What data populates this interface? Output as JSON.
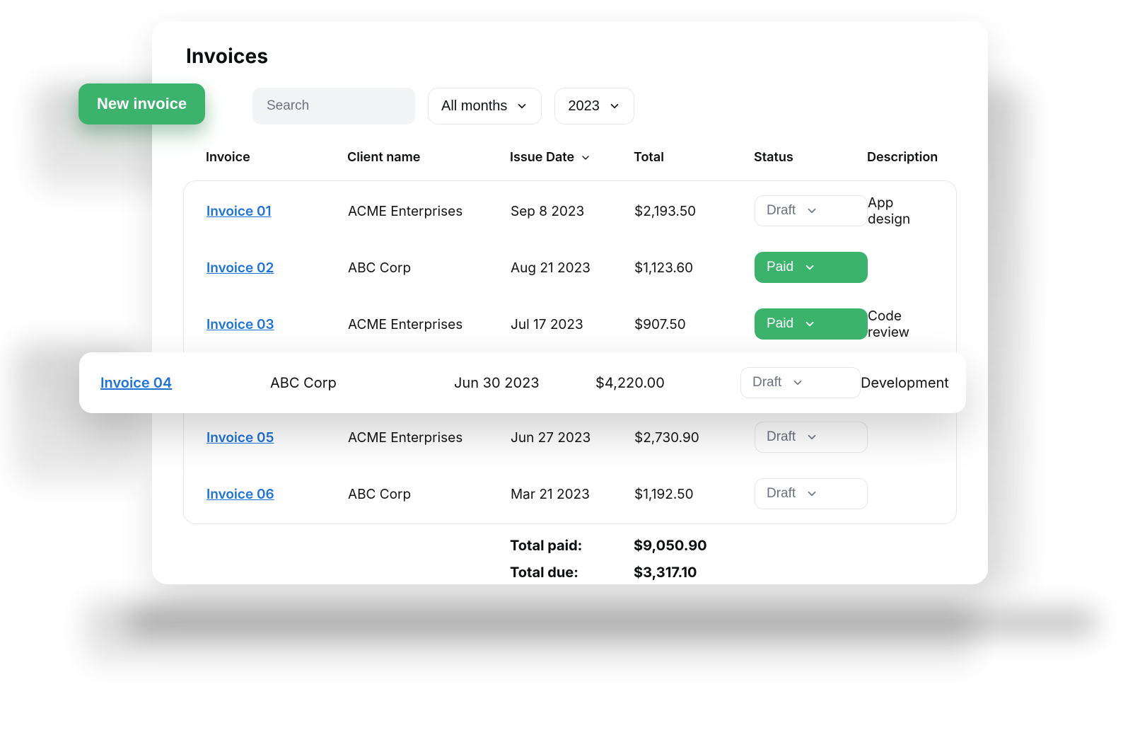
{
  "page": {
    "title": "Invoices"
  },
  "toolbar": {
    "new_label": "New invoice",
    "search_placeholder": "Search",
    "month_filter": "All months",
    "year_filter": "2023"
  },
  "columns": {
    "invoice": "Invoice",
    "client": "Client name",
    "issue": "Issue Date",
    "total": "Total",
    "status": "Status",
    "desc": "Description"
  },
  "statuses": {
    "draft": "Draft",
    "paid": "Paid"
  },
  "rows": [
    {
      "id": "Invoice 01",
      "client": "ACME Enterprises",
      "date": "Sep 8 2023",
      "total": "$2,193.50",
      "status": "draft",
      "desc": "App design"
    },
    {
      "id": "Invoice 02",
      "client": "ABC Corp",
      "date": "Aug 21 2023",
      "total": "$1,123.60",
      "status": "paid",
      "desc": ""
    },
    {
      "id": "Invoice 03",
      "client": "ACME Enterprises",
      "date": "Jul 17 2023",
      "total": "$907.50",
      "status": "paid",
      "desc": "Code review"
    },
    {
      "id": "Invoice 04",
      "client": "ABC Corp",
      "date": "Jun 30 2023",
      "total": "$4,220.00",
      "status": "draft",
      "desc": "Development"
    },
    {
      "id": "Invoice 05",
      "client": "ACME Enterprises",
      "date": "Jun 27 2023",
      "total": "$2,730.90",
      "status": "draft",
      "desc": ""
    },
    {
      "id": "Invoice 06",
      "client": "ABC Corp",
      "date": "Mar 21 2023",
      "total": "$1,192.50",
      "status": "draft",
      "desc": ""
    }
  ],
  "totals": {
    "paid_label": "Total paid:",
    "paid_value": "$9,050.90",
    "due_label": "Total due:",
    "due_value": "$3,317.10"
  },
  "colors": {
    "accent_green": "#3cb36c",
    "link_blue": "#1d72d6"
  },
  "icons": {
    "chevron_down": "chevron-down-icon"
  }
}
